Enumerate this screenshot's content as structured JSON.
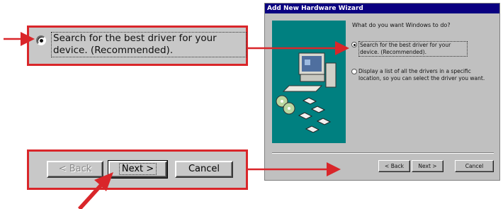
{
  "zoom_radio": {
    "label": "Search for the best driver for your device. (Recommended)."
  },
  "zoom_buttons": {
    "back": "< Back",
    "next": "Next >",
    "cancel": "Cancel"
  },
  "wizard": {
    "title": "Add New Hardware Wizard",
    "prompt": "What do you want Windows to do?",
    "option1": "Search for the best driver for your device. (Recommended).",
    "option2": "Display a list of all the drivers in a specific location, so you can select the driver you want.",
    "option1_selected": true,
    "buttons": {
      "back": "< Back",
      "next": "Next >",
      "cancel": "Cancel"
    }
  },
  "colors": {
    "callout_red": "#d9262a",
    "titlebar_blue": "#0a0080",
    "window_gray": "#c0c0c0",
    "art_teal": "#008080"
  },
  "icons": [
    "arrow-right-icon",
    "arrow-pointer-icon",
    "computer-icon",
    "floppy-disk-icon",
    "cd-icon"
  ]
}
